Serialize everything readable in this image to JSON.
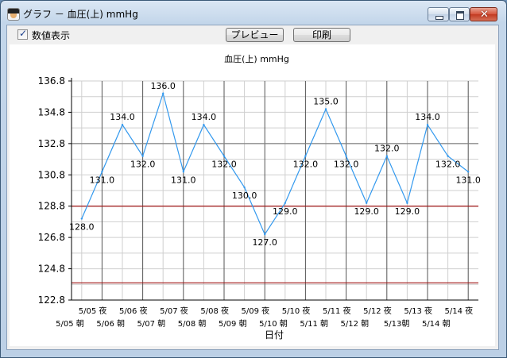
{
  "window": {
    "title": "グラフ － 血圧(上) mmHg",
    "close_glyph": "✕"
  },
  "toolbar": {
    "show_values_label": "数値表示",
    "show_values_checked": true,
    "preview_label": "プレビュー",
    "print_label": "印刷"
  },
  "chart_data": {
    "type": "line",
    "title": "血圧(上) mmHg",
    "xlabel": "日付",
    "ylabel": "",
    "ylim": [
      122.8,
      136.8
    ],
    "yticks": [
      "136.8",
      "134.8",
      "132.8",
      "130.8",
      "128.8",
      "126.8",
      "124.8",
      "122.8"
    ],
    "categories": [
      "5/05 朝",
      "5/05 夜",
      "5/06 朝",
      "5/06 夜",
      "5/07 朝",
      "5/07 夜",
      "5/08 朝",
      "5/08 夜",
      "5/09 朝",
      "5/09 夜",
      "5/10 朝",
      "5/10 夜",
      "5/11 朝",
      "5/11 夜",
      "5/12 朝",
      "5/12 夜",
      "5/13朝",
      "5/13 夜",
      "5/14 朝",
      "5/14 夜"
    ],
    "series": [
      {
        "values": [
          128.0,
          131.0,
          134.0,
          132.0,
          136.0,
          131.0,
          134.0,
          132.0,
          130.0,
          127.0,
          129.0,
          132.0,
          135.0,
          132.0,
          129.0,
          132.0,
          129.0,
          134.0,
          132.0,
          131.0
        ],
        "labels": [
          "128.0",
          "131.0",
          "134.0",
          "132.0",
          "136.0",
          "131.0",
          "134.0",
          "132.0",
          "130.0",
          "127.0",
          "129.0",
          "132.0",
          "135.0",
          "132.0",
          "129.0",
          "132.0",
          "129.0",
          "134.0",
          "132.0",
          "131.0"
        ],
        "color": "#3399ee"
      }
    ],
    "reference_lines": [
      {
        "value": 132.8,
        "color": "#808080"
      },
      {
        "value": 128.8,
        "color": "#a01515"
      },
      {
        "value": 123.9,
        "color": "#a01515"
      }
    ],
    "grid": true,
    "grid_color": "#cfcfcf",
    "day_divider_color": "#555555"
  }
}
